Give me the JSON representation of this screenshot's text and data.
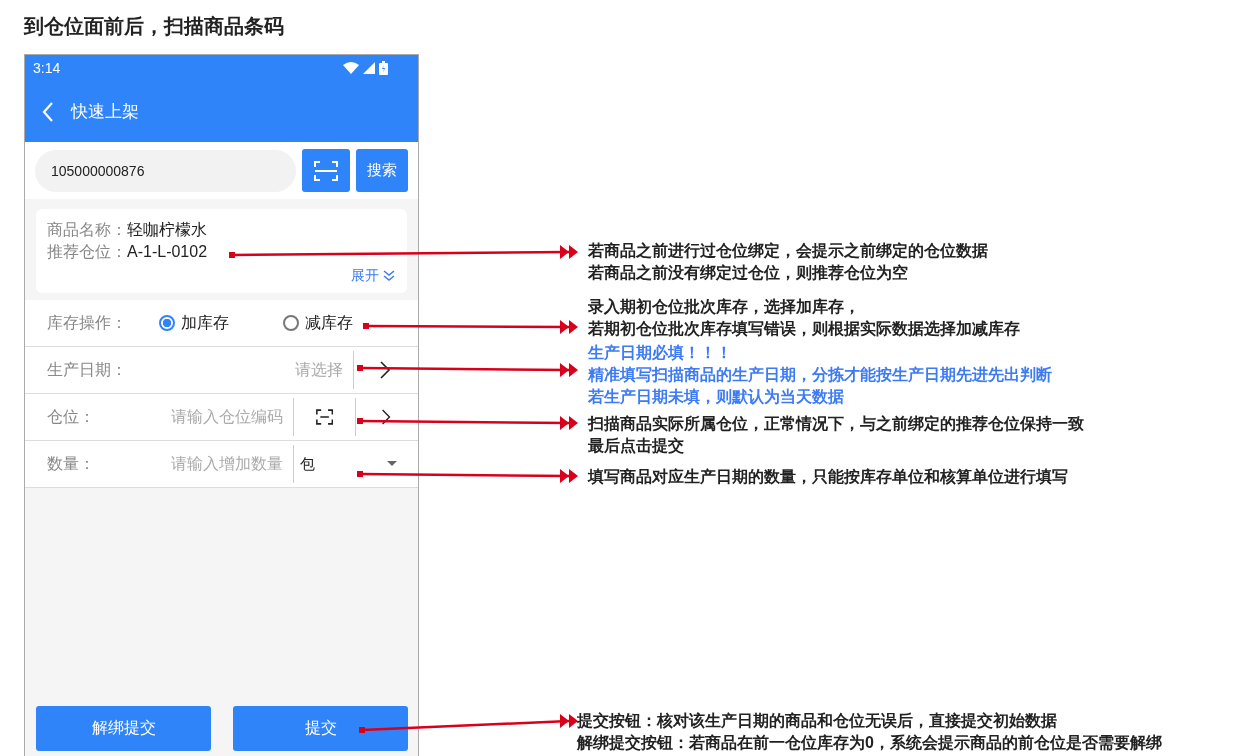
{
  "heading": "到仓位面前后，扫描商品条码",
  "phone": {
    "status_bar": {
      "time": "3:14"
    },
    "header": {
      "title": "快速上架"
    },
    "search": {
      "value": "105000000876",
      "button": "搜索"
    },
    "product": {
      "name_label": "商品名称：",
      "name": "轻咖柠檬水",
      "location_label": "推荐仓位：",
      "location": "A-1-L-0102",
      "expand": "展开"
    },
    "stock_op": {
      "label": "库存操作：",
      "options": [
        {
          "label": "加库存",
          "selected": true
        },
        {
          "label": "减库存",
          "selected": false
        }
      ]
    },
    "fields": [
      {
        "kind": "select",
        "label": "生产日期：",
        "placeholder": "请选择"
      },
      {
        "kind": "scan",
        "label": "仓位：",
        "placeholder": "请输入仓位编码"
      },
      {
        "kind": "unit",
        "label": "数量：",
        "placeholder": "请输入增加数量",
        "unit": "包"
      }
    ],
    "buttons": [
      "解绑提交",
      "提交"
    ]
  },
  "notes": [
    {
      "color": "#222222",
      "lines": [
        "若商品之前进行过仓位绑定，会提示之前绑定的仓位数据",
        "若商品之前没有绑定过仓位，则推荐仓位为空"
      ]
    },
    {
      "color": "#222222",
      "lines": [
        "录入期初仓位批次库存，选择加库存，",
        "若期初仓位批次库存填写错误，则根据实际数据选择加减库存"
      ]
    },
    {
      "color": "#3d7bf5",
      "lines": [
        "生产日期必填！！！",
        "精准填写扫描商品的生产日期，分拣才能按生产日期先进先出判断",
        "若生产日期未填，则默认为当天数据"
      ]
    },
    {
      "color": "#222222",
      "lines": [
        "扫描商品实际所属仓位，正常情况下，与之前绑定的推荐仓位保持一致",
        "最后点击提交"
      ]
    },
    {
      "color": "#222222",
      "lines": [
        "填写商品对应生产日期的数量，只能按库存单位和核算单位进行填写"
      ]
    },
    {
      "color": "#222222",
      "lines": [
        "提交按钮：核对该生产日期的商品和仓位无误后，直接提交初始数据",
        "解绑提交按钮：若商品在前一仓位库存为0，系统会提示商品的前仓位是否需要解绑"
      ]
    }
  ]
}
